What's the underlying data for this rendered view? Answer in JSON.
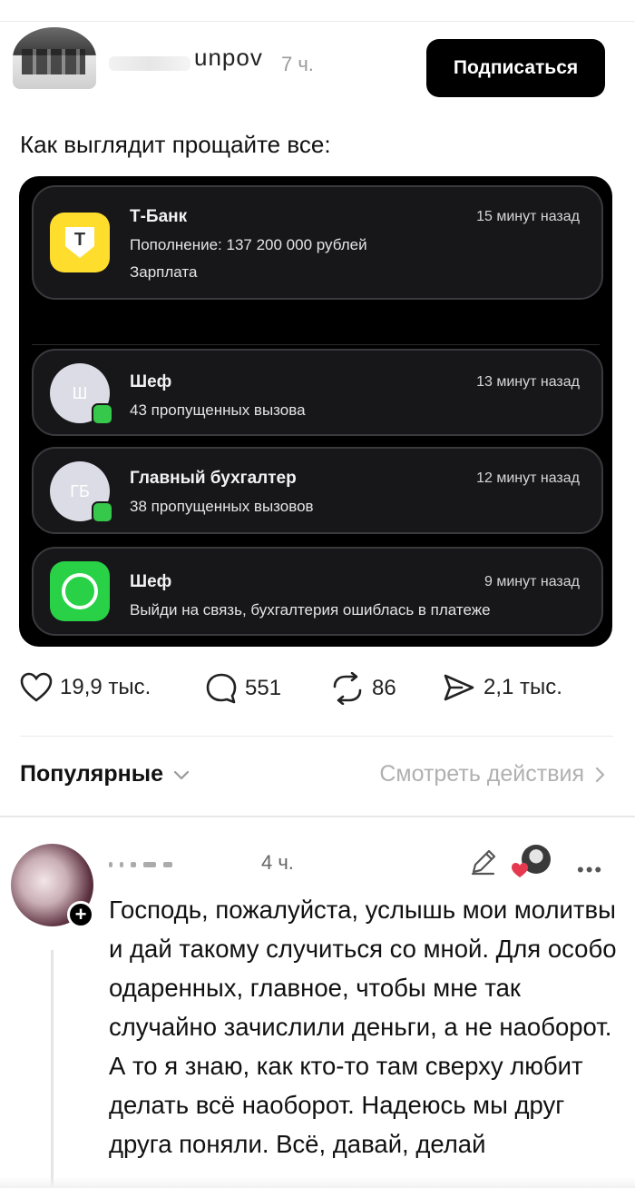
{
  "post": {
    "author": "unpov",
    "time": "7 ч.",
    "subscribe_label": "Подписаться",
    "text": "Как выглядит прощайте все:"
  },
  "notifications": [
    {
      "app": "tbank-icon",
      "title": "Т-Банк",
      "time": "15 минут назад",
      "line1": "Пополнение: 137 200 000 рублей",
      "line2": "Зарплата",
      "icon_letter": "Т"
    },
    {
      "app": "contact-icon",
      "title": "Шеф",
      "time": "13 минут назад",
      "line1": "43 пропущенных вызова",
      "icon_letter": "Ш"
    },
    {
      "app": "contact-icon",
      "title": "Главный бухгалтер",
      "time": "12 минут назад",
      "line1": "38 пропущенных вызовов",
      "icon_letter": "ГБ"
    },
    {
      "app": "whatsapp-icon",
      "title": "Шеф",
      "time": "9 минут назад",
      "line1": "Выйди на связь, бухгалтерия ошиблась в платеже"
    }
  ],
  "stats": {
    "likes": "19,9 тыс.",
    "comments": "551",
    "reposts": "86",
    "shares": "2,1 тыс."
  },
  "comments_header": {
    "sort_label": "Популярные",
    "view_actions_label": "Смотреть действия"
  },
  "comment": {
    "time": "4 ч.",
    "text": "Господь, пожалуйста, услышь мои молитвы и дай такому случиться со мной. Для особо одаренных, главное, чтобы мне так случайно зачислили деньги, а не наоборот. А то я знаю, как кто-то там сверху любит делать всё наоборот. Надеюсь мы друг друга поняли. Всё, давай, делай"
  },
  "colors": {
    "accent": "#000000",
    "tbank_yellow": "#ffdd2d",
    "whatsapp_green": "#28d146",
    "reaction_heart": "#e53950"
  }
}
